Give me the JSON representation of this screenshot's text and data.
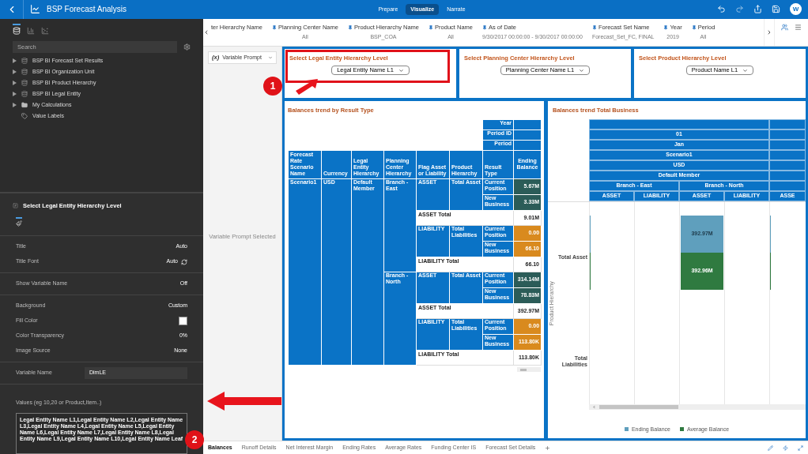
{
  "app": {
    "title": "BSP Forecast Analysis"
  },
  "modes": [
    {
      "label": "Prepare",
      "selected": false
    },
    {
      "label": "Visualize",
      "selected": true
    },
    {
      "label": "Narrate",
      "selected": false
    }
  ],
  "user": {
    "initial": "W"
  },
  "data_panel": {
    "tabs": [
      {
        "kind": "data",
        "selected": true
      },
      {
        "kind": "visualizations",
        "selected": false
      },
      {
        "kind": "analytics",
        "selected": false
      }
    ],
    "search": {
      "placeholder": "Search"
    },
    "items": [
      {
        "label": "BSP BI Forecast Set Results",
        "kind": "source"
      },
      {
        "label": "BSP BI Organization Unit",
        "kind": "source"
      },
      {
        "label": "BSP BI Product Hierarchy",
        "kind": "source"
      },
      {
        "label": "BSP BI Legal Entity",
        "kind": "source"
      },
      {
        "label": "My Calculations",
        "kind": "folder"
      },
      {
        "label": "Value Labels",
        "kind": "labels"
      }
    ]
  },
  "properties": {
    "title": "Select Legal Entity Hierarchy Level",
    "sections": [
      [
        {
          "kind": "value",
          "label": "Title",
          "value": "Auto"
        },
        {
          "kind": "font",
          "label": "Title Font",
          "value": "Auto"
        }
      ],
      [
        {
          "kind": "value",
          "label": "Show Variable Name",
          "value": "Off"
        }
      ],
      [
        {
          "kind": "value",
          "label": "Background",
          "value": "Custom"
        },
        {
          "kind": "swatch",
          "label": "Fill Color",
          "color": "#ffffff"
        },
        {
          "kind": "value",
          "label": "Color Transparency",
          "value": "0%"
        },
        {
          "kind": "value",
          "label": "Image Source",
          "value": "None"
        }
      ],
      [
        {
          "kind": "input",
          "label": "Variable Name",
          "value": "DimLE"
        }
      ]
    ],
    "values_field": {
      "label": "Values (eg 10,20 or Product,Item..)",
      "value": "Legal Entity Name L1,Legal Entity Name L2,Legal Entity Name L3,Legal Entity Name L4,Legal Entity Name L5,Legal Entity Name L6,Legal Entity Name L7,Legal Entity Name L8,Legal Entity Name L9,Legal Entity Name L10,Legal Entity Name Leaf"
    }
  },
  "filters": [
    {
      "name": "ter Hierarchy Name"
    },
    {
      "name": "Planning Center Name",
      "value": "All"
    },
    {
      "name": "Product Hierarchy Name",
      "value": "BSP_COA"
    },
    {
      "name": "Product Name",
      "value": "All"
    },
    {
      "name": "As of Date",
      "value": "9/30/2017 00:00:00 - 9/30/2017 00:00:00"
    },
    {
      "name": "Forecast Set Name",
      "value": "Forecast_Set_FC, FINAL"
    },
    {
      "name": "Year",
      "value": "2019"
    },
    {
      "name": "Period",
      "value": "All"
    }
  ],
  "prompt_strip": {
    "icon_text": "(x)",
    "dropdown": "Variable Prompt",
    "note": "Variable Prompt Selected"
  },
  "prompts": [
    {
      "title": "Select Legal Entity Hierarchy Level",
      "selection": "Legal Entity Name L1",
      "highlighted": true
    },
    {
      "title": "Select Planning Center Hierarchy Level",
      "selection": "Planning Center Name L1",
      "highlighted": false
    },
    {
      "title": "Select Product Hierarchy Level",
      "selection": "Product Name L1",
      "highlighted": false
    }
  ],
  "balances_table": {
    "title": "Balances trend by Result Type",
    "period_headers": [
      "Year",
      "Period ID",
      "Period"
    ],
    "columns": [
      "Forecast Rate Scenario Name",
      "Currency",
      "Legal Entity Hierarchy",
      "Planning Center Hierarchy",
      "Flag Asset or Liability",
      "Product Hierarchy",
      "Result Type",
      "Ending Balance"
    ],
    "scenario": "Scenario1",
    "currency": "USD",
    "legal_entity": "Default Member",
    "branches": [
      {
        "name": "Branch - East",
        "groups": [
          {
            "flag": "ASSET",
            "product": "Total Asset",
            "color": "#2b5c58",
            "results": [
              {
                "type": "Current Position",
                "value": "5.67M"
              },
              {
                "type": "New Business",
                "value": "3.33M"
              }
            ],
            "total_label": "ASSET Total",
            "total": "9.01M"
          },
          {
            "flag": "LIABILITY",
            "product": "Total Liabilities",
            "color": "#d98a1e",
            "results": [
              {
                "type": "Current Position",
                "value": "0.00"
              },
              {
                "type": "New Business",
                "value": "66.10"
              }
            ],
            "total_label": "LIABILITY Total",
            "total": "66.10"
          }
        ]
      },
      {
        "name": "Branch - North",
        "groups": [
          {
            "flag": "ASSET",
            "product": "Total Asset",
            "color": "#2b5c58",
            "results": [
              {
                "type": "Current Position",
                "value": "314.14M"
              },
              {
                "type": "New Business",
                "value": "78.83M"
              }
            ],
            "total_label": "ASSET Total",
            "total": "392.97M"
          },
          {
            "flag": "LIABILITY",
            "product": "Total Liabilities",
            "color": "#d98a1e",
            "results": [
              {
                "type": "Current Position",
                "value": "0.00"
              },
              {
                "type": "New Business",
                "value": "113.80K"
              }
            ],
            "total_label": "LIABILITY Total",
            "total": "113.80K"
          }
        ]
      }
    ]
  },
  "total_business": {
    "title": "Balances trend Total Business",
    "header_rows": [
      "01",
      "Jan",
      "Scenario1",
      "USD",
      "Default Member"
    ],
    "branches": [
      "Branch - East",
      "Branch - North"
    ],
    "flags": [
      "ASSET",
      "LIABILITY",
      "ASSET",
      "LIABILITY",
      "ASSE"
    ],
    "axis_label": "Product Hierarchy",
    "row_labels": [
      "Total Asset",
      "Total Liabilities"
    ],
    "blocks": [
      {
        "label": "392.97M",
        "color": "#5f9fbd"
      },
      {
        "label": "392.96M",
        "color": "#2f7a40"
      }
    ],
    "legend": [
      {
        "label": "Ending Balance",
        "color": "#5f9fbd"
      },
      {
        "label": "Average Balance",
        "color": "#2f7a40"
      }
    ]
  },
  "sheet_tabs": [
    {
      "label": "Balances",
      "selected": true
    },
    {
      "label": "Runoff Details",
      "selected": false
    },
    {
      "label": "Net Interest Margin",
      "selected": false
    },
    {
      "label": "Ending Rates",
      "selected": false
    },
    {
      "label": "Average Rates",
      "selected": false
    },
    {
      "label": "Funding Center IS",
      "selected": false
    },
    {
      "label": "Forecast Set Details",
      "selected": false
    }
  ],
  "annotations": [
    {
      "label": "1"
    },
    {
      "label": "2"
    }
  ]
}
